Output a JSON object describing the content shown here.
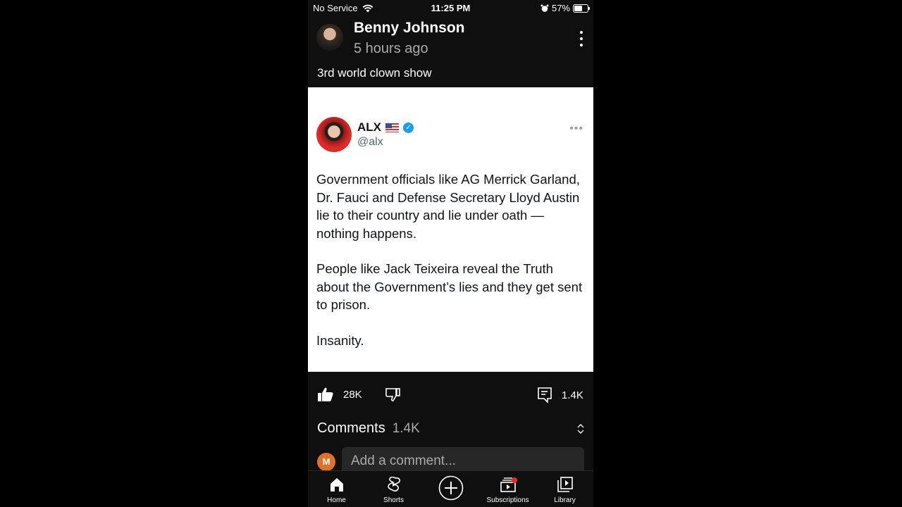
{
  "status_bar": {
    "carrier": "No Service",
    "time": "11:25 PM",
    "battery_percent": "57%",
    "battery_level": 0.57,
    "icons": [
      "wifi-icon",
      "alarm-icon",
      "battery-icon"
    ]
  },
  "post": {
    "channel_name": "Benny Johnson",
    "posted_ago": "5 hours ago",
    "caption": "3rd world clown show"
  },
  "tweet": {
    "display_name": "ALX",
    "flag": "US flag",
    "verified": true,
    "handle": "@alx",
    "paragraphs": [
      "Government officials like AG Merrick Garland, Dr. Fauci and Defense Secretary Lloyd Austin lie to their country and lie under oath — nothing happens.",
      "People like Jack Teixeira reveal the Truth about the Government’s lies and they get sent to prison.",
      "Insanity."
    ]
  },
  "actions": {
    "likes": "28K",
    "comments_count": "1.4K"
  },
  "comments": {
    "title": "Comments",
    "count": "1.4K",
    "user_initial": "M",
    "input_placeholder": "Add a comment..."
  },
  "tabbar": {
    "items": [
      {
        "label": "Home",
        "icon": "home-icon"
      },
      {
        "label": "Shorts",
        "icon": "shorts-icon"
      },
      {
        "label": "",
        "icon": "create-icon"
      },
      {
        "label": "Subscriptions",
        "icon": "subscriptions-icon",
        "badge": true
      },
      {
        "label": "Library",
        "icon": "library-icon"
      }
    ]
  },
  "colors": {
    "background": "#0f0f0f",
    "verified_blue": "#1d9bf0",
    "notification_red": "#f1252b",
    "avatar_orange": "#e0712a"
  }
}
